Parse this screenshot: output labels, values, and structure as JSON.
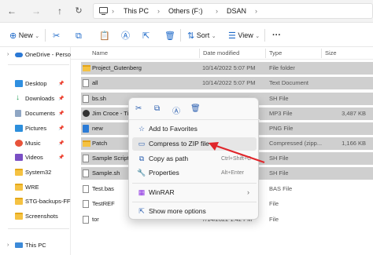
{
  "address_bar": {
    "crumbs": [
      "This PC",
      "Others (F:)",
      "DSAN"
    ],
    "separator": ">"
  },
  "toolbar": {
    "new_label": "New",
    "sort_label": "Sort",
    "view_label": "View",
    "more_label": "···",
    "accent_color": "#1c68c8"
  },
  "sidebar": {
    "onedrive_label": "OneDrive - Perso",
    "items": [
      {
        "label": "Desktop",
        "icon": "desktop-icon"
      },
      {
        "label": "Downloads",
        "icon": "downloads-icon"
      },
      {
        "label": "Documents",
        "icon": "documents-icon"
      },
      {
        "label": "Pictures",
        "icon": "pictures-icon"
      },
      {
        "label": "Music",
        "icon": "music-icon"
      },
      {
        "label": "Videos",
        "icon": "videos-icon"
      },
      {
        "label": "System32",
        "icon": "folder-icon"
      },
      {
        "label": "WRE",
        "icon": "folder-icon"
      },
      {
        "label": "STG-backups-FF",
        "icon": "folder-icon"
      },
      {
        "label": "Screenshots",
        "icon": "folder-icon"
      }
    ],
    "this_pc_label": "This PC"
  },
  "columns": {
    "name": "Name",
    "date": "Date modified",
    "type": "Type",
    "size": "Size"
  },
  "files": [
    {
      "name": "Project_Gutenberg",
      "date": "10/14/2022 5:07 PM",
      "type": "File folder",
      "size": "",
      "icon": "folder",
      "selected": true
    },
    {
      "name": "all",
      "date": "10/14/2022 5:07 PM",
      "type": "Text Document",
      "size": "",
      "icon": "doc",
      "selected": true
    },
    {
      "name": "bs.sh",
      "date": "",
      "type": "SH File",
      "size": "",
      "icon": "doc",
      "selected": true
    },
    {
      "name": "Jim Croce - Tim",
      "date": "",
      "type": "MP3 File",
      "size": "3,487 KB",
      "icon": "mp3",
      "selected": true
    },
    {
      "name": "new",
      "date": "",
      "type": "PNG File",
      "size": "",
      "icon": "png",
      "selected": true
    },
    {
      "name": "Patch",
      "date": "",
      "type": "Compressed (zipp...",
      "size": "1,166 KB",
      "icon": "folder",
      "selected": true
    },
    {
      "name": "Sample Script",
      "date": "",
      "type": "SH File",
      "size": "",
      "icon": "doc",
      "selected": true
    },
    {
      "name": "Sample.sh",
      "date": "",
      "type": "SH File",
      "size": "",
      "icon": "doc",
      "selected": true
    },
    {
      "name": "Test.bas",
      "date": "",
      "type": "BAS File",
      "size": "",
      "icon": "doc",
      "selected": false
    },
    {
      "name": "TestREF",
      "date": "",
      "type": "File",
      "size": "",
      "icon": "doc",
      "selected": false
    },
    {
      "name": "tor",
      "date": "7/14/2022 1:42 PM",
      "type": "File",
      "size": "",
      "icon": "doc",
      "selected": false
    }
  ],
  "context_menu": {
    "quick_icons": [
      "cut-icon",
      "copy-icon",
      "rename-icon",
      "delete-icon"
    ],
    "items": [
      {
        "label": "Add to Favorites",
        "icon": "star-icon",
        "shortcut": "",
        "submenu": false
      },
      {
        "label": "Compress to ZIP file",
        "icon": "zip-icon",
        "shortcut": "",
        "submenu": false,
        "highlighted": true
      },
      {
        "label": "Copy as path",
        "icon": "copy-path-icon",
        "shortcut": "Ctrl+Shift+C",
        "submenu": false
      },
      {
        "label": "Properties",
        "icon": "properties-icon",
        "shortcut": "Alt+Enter",
        "submenu": false
      },
      {
        "label": "WinRAR",
        "icon": "winrar-icon",
        "shortcut": "",
        "submenu": true
      },
      {
        "label": "Show more options",
        "icon": "more-options-icon",
        "shortcut": "",
        "submenu": false
      }
    ]
  },
  "annotation_color": "#e0262b"
}
